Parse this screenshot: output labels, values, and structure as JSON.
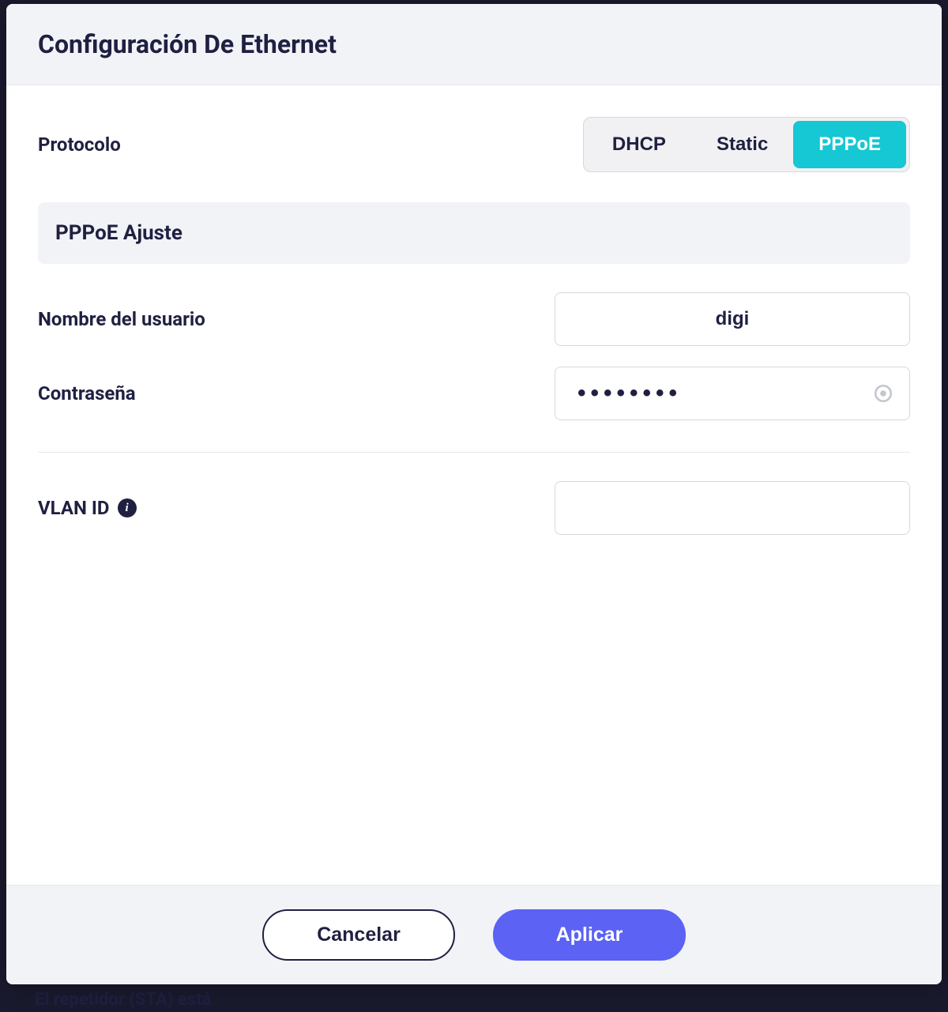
{
  "modal": {
    "title": "Configuración De Ethernet",
    "protocol": {
      "label": "Protocolo",
      "options": {
        "dhcp": "DHCP",
        "static": "Static",
        "pppoe": "PPPoE"
      },
      "selected": "pppoe"
    },
    "pppoe_section": {
      "title": "PPPoE Ajuste",
      "username": {
        "label": "Nombre del usuario",
        "value": "digi"
      },
      "password": {
        "label": "Contraseña",
        "value": "••••••••"
      }
    },
    "vlan": {
      "label": "VLAN ID",
      "value": ""
    },
    "footer": {
      "cancel": "Cancelar",
      "apply": "Aplicar"
    }
  },
  "background": {
    "bottom_text": "El repetidor (STA) está"
  }
}
